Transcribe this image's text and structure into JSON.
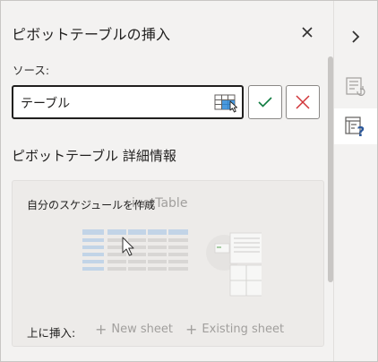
{
  "pane": {
    "title": "ピボットテーブルの挿入",
    "close_icon": "close-icon"
  },
  "source": {
    "label": "ソース:",
    "value": "テーブル",
    "picker_icon": "table-range-select-icon",
    "confirm_icon": "checkmark-icon",
    "cancel_icon": "cancel-x-icon",
    "confirm_color": "#107c41",
    "cancel_color": "#d13438"
  },
  "details": {
    "section_title": "ピボットテーブル 詳細情報",
    "card": {
      "heading": "自分のスケジュールを作成",
      "heading_ghost": "ivotTable",
      "illustration": "pivot-table-illustration",
      "insert_label": "上に挿入:",
      "options": [
        {
          "label": "New sheet",
          "enabled": false
        },
        {
          "label": "Existing sheet",
          "enabled": false
        }
      ]
    }
  },
  "rail": {
    "items": [
      {
        "icon": "chevron-right-icon",
        "active": false
      },
      {
        "icon": "pivot-recommend-icon",
        "active": false
      },
      {
        "icon": "pivot-help-icon",
        "active": true
      }
    ]
  },
  "colors": {
    "pane_bg": "#f3f2f1",
    "card_bg": "#edebe9",
    "accent_blue": "#2b579a",
    "disabled_text": "#a19f9d"
  }
}
